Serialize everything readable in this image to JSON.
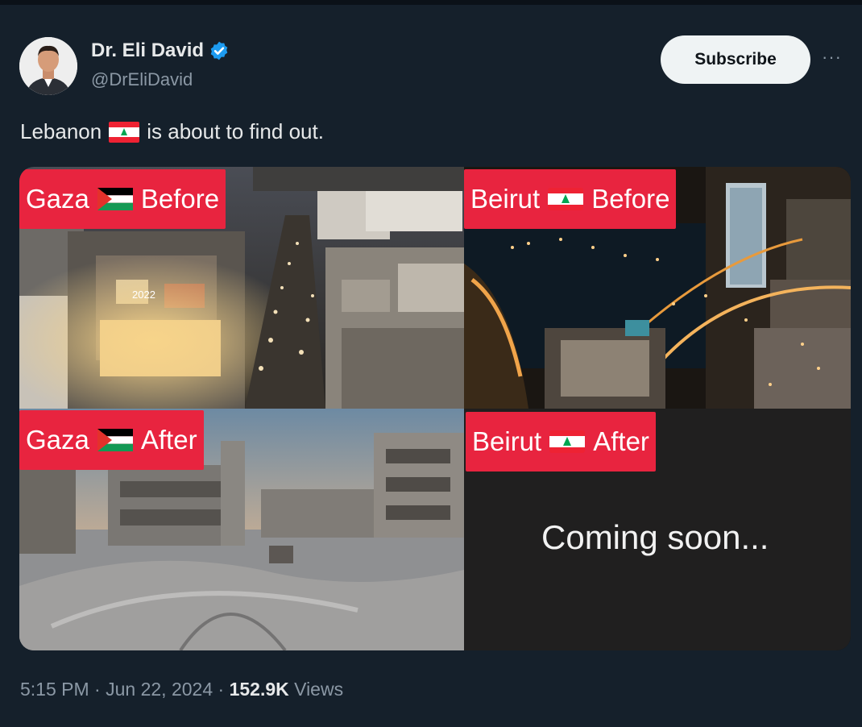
{
  "author": {
    "name": "Dr. Eli David",
    "handle": "@DrEliDavid",
    "verified": true
  },
  "actions": {
    "subscribe_label": "Subscribe",
    "more_label": "···"
  },
  "tweet": {
    "text_before_flag": "Lebanon",
    "text_after_flag": "is about to find out."
  },
  "media": {
    "panels": [
      {
        "city": "Gaza",
        "stage": "Before"
      },
      {
        "city": "Beirut",
        "stage": "Before"
      },
      {
        "city": "Gaza",
        "stage": "After"
      },
      {
        "city": "Beirut",
        "stage": "After",
        "overlay_text": "Coming soon..."
      }
    ],
    "sign_text": "2022"
  },
  "meta": {
    "time": "5:15 PM",
    "separator": "·",
    "date": "Jun 22, 2024",
    "views_count": "152.9K",
    "views_label": "Views"
  },
  "colors": {
    "background": "#15202b",
    "tag_red": "#e8243f",
    "verified_blue": "#1d9bf0",
    "muted_text": "#8b98a5"
  }
}
